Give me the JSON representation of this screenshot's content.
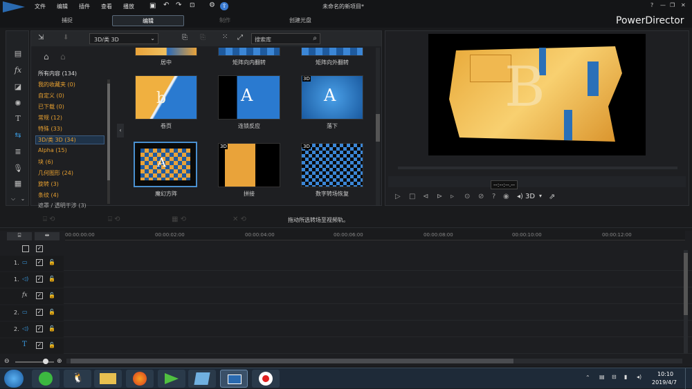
{
  "menu": [
    "文件",
    "编辑",
    "插件",
    "查看",
    "播放"
  ],
  "window_title": "未命名的新项目*",
  "modes": [
    "捕捉",
    "编辑",
    "制作",
    "创建光盘"
  ],
  "brand": "PowerDirector",
  "library": {
    "dropdown": "3D/类 3D",
    "search_placeholder": "搜索库",
    "categories": [
      "所有内容 (134)",
      "我的收藏夹 (0)",
      "自定义 (0)",
      "已下载 (0)",
      "常规 (12)",
      "特殊 (33)",
      "3D/类 3D (34)",
      "Alpha (15)",
      "块 (6)",
      "几何图形 (24)",
      "旋转 (3)",
      "条纹 (4)",
      "遮罩 / 透明干涉 (3)"
    ],
    "transitions": [
      {
        "label": "居中"
      },
      {
        "label": "矩阵向内翻转"
      },
      {
        "label": "矩阵向外翻转"
      },
      {
        "label": "卷页"
      },
      {
        "label": "连锁反应"
      },
      {
        "label": "落下"
      },
      {
        "label": "魔幻方阵"
      },
      {
        "label": "拼接"
      },
      {
        "label": "数字转场恢复"
      }
    ],
    "badge_3d": "3D"
  },
  "preview": {
    "timecode": "--:--:--.--",
    "mode_3d": "3D"
  },
  "hint": "拖动所选转场至视频轨。",
  "ruler": [
    "00:00:00:00",
    "00:00:02:00",
    "00:00:04:00",
    "00:00:06:00",
    "00:00:08:00",
    "00:00:10:00",
    "00:00:12:00"
  ],
  "tracks": [
    "1.",
    "1.",
    "",
    "2.",
    "2.",
    ""
  ],
  "clock": {
    "time": "10:10",
    "date": "2019/4/7"
  },
  "window_buttons": [
    "?",
    "—",
    "❐",
    "✕"
  ],
  "colors": {
    "accent": "#e8a030",
    "highlight": "#4a90d0"
  }
}
